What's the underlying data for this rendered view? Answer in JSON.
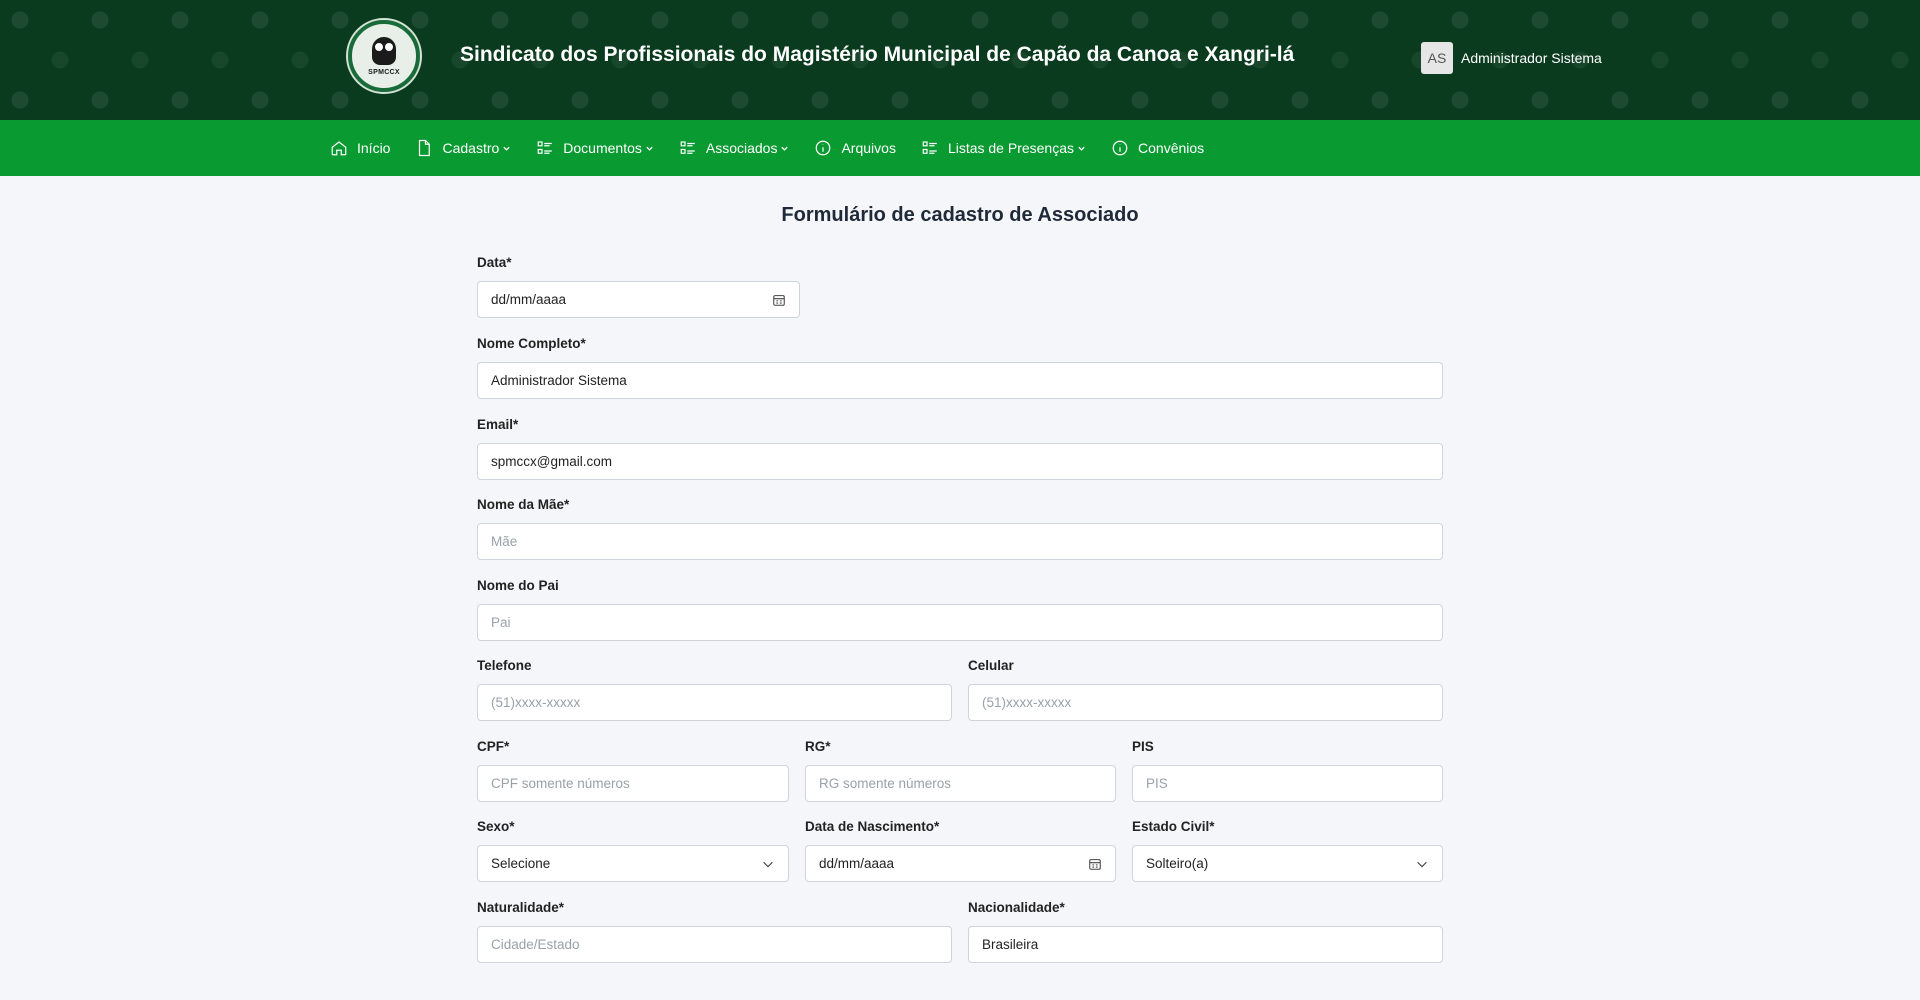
{
  "header": {
    "logo_text": "SPMCCX",
    "title": "Sindicato dos Profissionais do Magistério Municipal de Capão da Canoa e Xangri-lá",
    "user_initials": "AS",
    "user_name": "Administrador Sistema"
  },
  "nav": {
    "items": [
      {
        "label": "Início",
        "icon": "home-icon"
      },
      {
        "label": "Cadastro",
        "icon": "document-icon"
      },
      {
        "label": "Documentos",
        "icon": "list-icon"
      },
      {
        "label": "Associados",
        "icon": "list-icon"
      },
      {
        "label": "Arquivos",
        "icon": "info-icon"
      },
      {
        "label": "Listas de Presenças",
        "icon": "list-icon"
      },
      {
        "label": "Convênios",
        "icon": "info-icon"
      }
    ]
  },
  "form": {
    "title": "Formulário de cadastro de Associado",
    "data": {
      "label": "Data*",
      "value": "dd/mm/aaaa"
    },
    "nome": {
      "label": "Nome Completo*",
      "value": "Administrador Sistema"
    },
    "email": {
      "label": "Email*",
      "value": "spmccx@gmail.com"
    },
    "mae": {
      "label": "Nome da Mãe*",
      "placeholder": "Mãe"
    },
    "pai": {
      "label": "Nome do Pai",
      "placeholder": "Pai"
    },
    "telefone": {
      "label": "Telefone",
      "placeholder": "(51)xxxx-xxxxx"
    },
    "celular": {
      "label": "Celular",
      "placeholder": "(51)xxxx-xxxxx"
    },
    "cpf": {
      "label": "CPF*",
      "placeholder": "CPF somente números"
    },
    "rg": {
      "label": "RG*",
      "placeholder": "RG somente números"
    },
    "pis": {
      "label": "PIS",
      "placeholder": "PIS"
    },
    "sexo": {
      "label": "Sexo*",
      "value": "Selecione"
    },
    "nascimento": {
      "label": "Data de Nascimento*",
      "value": "dd/mm/aaaa"
    },
    "estado_civil": {
      "label": "Estado Civil*",
      "value": "Solteiro(a)"
    },
    "naturalidade": {
      "label": "Naturalidade*",
      "placeholder": "Cidade/Estado"
    },
    "nacionalidade": {
      "label": "Nacionalidade*",
      "value": "Brasileira"
    }
  },
  "colors": {
    "header_bg": "#0b3b1f",
    "nav_bg": "#0a9a32",
    "page_bg": "#f4f6f9"
  }
}
